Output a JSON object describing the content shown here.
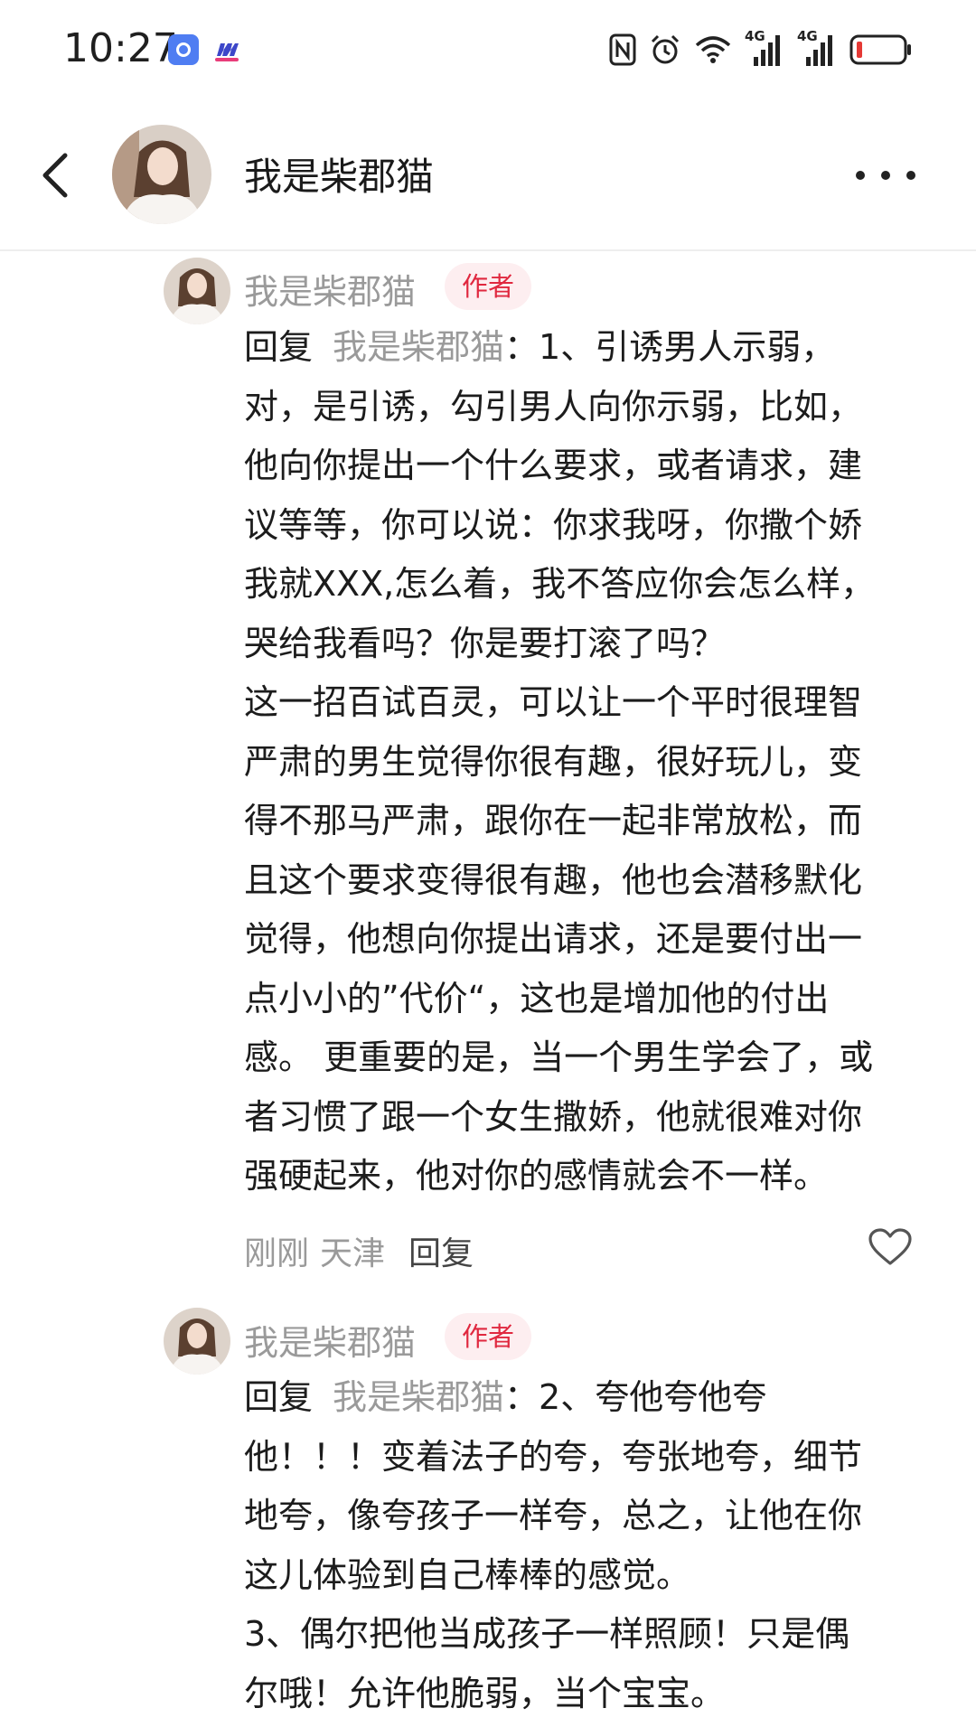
{
  "status_bar": {
    "time": "10:27",
    "network_1": "4G",
    "network_2": "4G"
  },
  "header": {
    "title": "我是柴郡猫"
  },
  "comments": [
    {
      "author": "我是柴郡猫",
      "badge": "作者",
      "reply_prefix": "回复",
      "reply_target": "我是柴郡猫",
      "lines": [
        "：1、引诱男人示弱，",
        "对，是引诱，勾引男人向你示弱，比如，",
        "他向你提出一个什么要求，或者请求，建",
        "议等等，你可以说：你求我呀，你撒个娇",
        "我就XXX,怎么着，我不答应你会怎么样，",
        "哭给我看吗？你是要打滚了吗？",
        "这一招百试百灵，可以让一个平时很理智",
        "严肃的男生觉得你很有趣，很好玩儿，变",
        "得不那马严肃，跟你在一起非常放松，而",
        "且这个要求变得很有趣，他也会潜移默化",
        "觉得，他想向你提出请求，还是要付出一",
        "点小小的”代价“，这也是增加他的付出",
        "感。 更重要的是，当一个男生学会了，或",
        "者习惯了跟一个女生撒娇，他就很难对你",
        "强硬起来，他对你的感情就会不一样。"
      ],
      "time": "刚刚",
      "location": "天津",
      "reply_label": "回复"
    },
    {
      "author": "我是柴郡猫",
      "badge": "作者",
      "reply_prefix": "回复",
      "reply_target": "我是柴郡猫",
      "lines": [
        "：2、夸他夸他夸",
        "他！！！变着法子的夸，夸张地夸，细节",
        "地夸，像夸孩子一样夸，总之，让他在你",
        "这儿体验到自己棒棒的感觉。",
        "3、偶尔把他当成孩子一样照顾！只是偶",
        "尔哦！允许他脆弱，当个宝宝。"
      ]
    }
  ],
  "colors": {
    "badge_bg": "#fdeef0",
    "badge_text": "#e0283f",
    "muted": "#9a9a9a",
    "battery_low": "#e53935"
  }
}
